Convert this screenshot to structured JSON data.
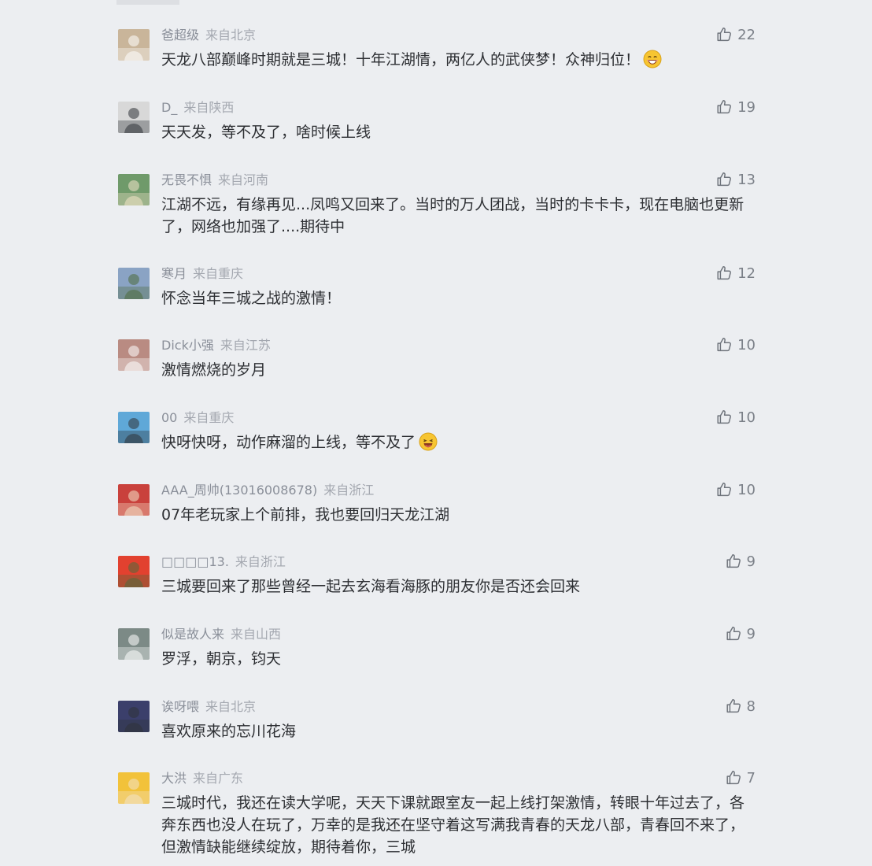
{
  "like_icon": "thumbs-up-icon",
  "comments": [
    {
      "username": "爸超级",
      "location": "来自北京",
      "likes": "22",
      "text": "天龙八部巅峰时期就是三城！十年江湖情，两亿人的武侠梦！众神归位！",
      "emoji": "grinning-emoji",
      "avatar_color": "#c9b59a"
    },
    {
      "username": "D_",
      "location": "来自陕西",
      "likes": "19",
      "text": "天天发，等不及了，啥时候上线",
      "avatar_color": "#d8d8d8"
    },
    {
      "username": "无畏不惧",
      "location": "来自河南",
      "likes": "13",
      "text": "江湖不远，有缘再见...凤鸣又回来了。当时的万人团战，当时的卡卡卡，现在电脑也更新了，网络也加强了....期待中",
      "avatar_color": "#6f9a6a"
    },
    {
      "username": "寒月",
      "location": "来自重庆",
      "likes": "12",
      "text": "怀念当年三城之战的激情！",
      "avatar_color": "#8aa3c4"
    },
    {
      "username": "Dick小强",
      "location": "来自江苏",
      "likes": "10",
      "text": "激情燃烧的岁月",
      "avatar_color": "#b98b82"
    },
    {
      "username": "00",
      "location": "来自重庆",
      "likes": "10",
      "text": "快呀快呀，动作麻溜的上线，等不及了",
      "emoji": "laughing-emoji",
      "avatar_color": "#5fa8d8"
    },
    {
      "username": "AAA_周帅(13016008678)",
      "location": "来自浙江",
      "likes": "10",
      "text": "07年老玩家上个前排，我也要回归天龙江湖",
      "avatar_color": "#c9413c"
    },
    {
      "username": "□□□□13.",
      "location": "来自浙江",
      "likes": "9",
      "text": "三城要回来了那些曾经一起去玄海看海豚的朋友你是否还会回来",
      "avatar_color": "#e2412f"
    },
    {
      "username": "似是故人来",
      "location": "来自山西",
      "likes": "9",
      "text": "罗浮，朝京，钧天",
      "avatar_color": "#7c8a86"
    },
    {
      "username": "诶呀喂",
      "location": "来自北京",
      "likes": "8",
      "text": "喜欢原来的忘川花海",
      "avatar_color": "#3b3f6b"
    },
    {
      "username": "大洪",
      "location": "来自广东",
      "likes": "7",
      "text": "三城时代，我还在读大学呢，天天下课就跟室友一起上线打架激情，转眼十年过去了，各奔东西也没人在玩了，万幸的是我还在坚守着这写满我青春的天龙八部，青春回不来了，但激情缺能继续绽放，期待着你，三城",
      "avatar_color": "#f2c23a"
    }
  ]
}
